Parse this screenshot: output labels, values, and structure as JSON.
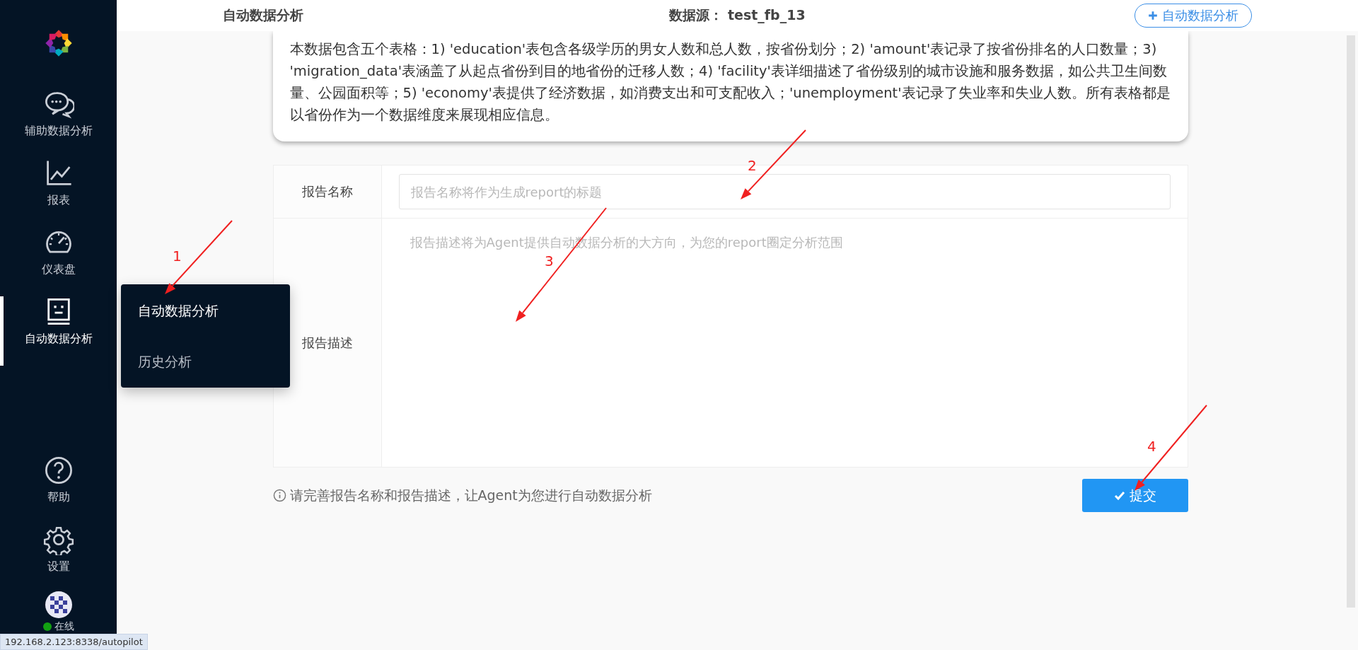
{
  "sidebar": {
    "items": [
      {
        "label": "辅助数据分析",
        "selected": false
      },
      {
        "label": "报表",
        "selected": false
      },
      {
        "label": "仪表盘",
        "selected": false
      },
      {
        "label": "自动数据分析",
        "selected": true
      }
    ],
    "bottom_items": [
      {
        "label": "帮助"
      },
      {
        "label": "设置"
      }
    ],
    "user": {
      "status": "在线",
      "online": true
    }
  },
  "submenu": {
    "items": [
      {
        "label": "自动数据分析",
        "selected": true
      },
      {
        "label": "历史分析",
        "selected": false
      }
    ]
  },
  "header": {
    "title": "自动数据分析",
    "datasource_label": "数据源：",
    "datasource_value": "test_fb_13",
    "new_button": "自动数据分析"
  },
  "description": "本数据包含五个表格：1) 'education'表包含各级学历的男女人数和总人数，按省份划分；2) 'amount'表记录了按省份排名的人口数量；3) 'migration_data'表涵盖了从起点省份到目的地省份的迁移人数；4) 'facility'表详细描述了省份级别的城市设施和服务数据，如公共卫生间数量、公园面积等；5) 'economy'表提供了经济数据，如消费支出和可支配收入；'unemployment'表记录了失业率和失业人数。所有表格都是以省份作为一个数据维度来展现相应信息。",
  "form": {
    "rows": [
      {
        "label": "报告名称",
        "kind": "input",
        "placeholder": "报告名称将作为生成report的标题"
      },
      {
        "label": "报告描述",
        "kind": "textarea",
        "placeholder": "报告描述将为Agent提供自动数据分析的大方向，为您的report圈定分析范围"
      }
    ],
    "hint": "请完善报告名称和报告描述，让Agent为您进行自动数据分析",
    "submit": "提交"
  },
  "annotations": [
    "1",
    "2",
    "3",
    "4"
  ],
  "status_url": "192.168.2.123:8338/autopilot"
}
